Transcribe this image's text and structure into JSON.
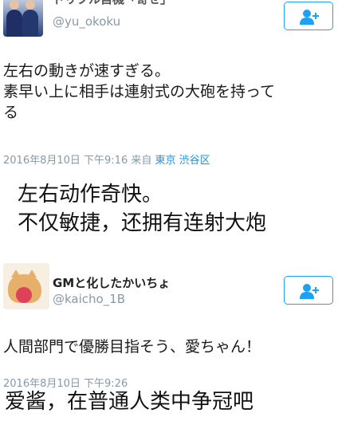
{
  "tweet1": {
    "author_name": "ドリブル自機「寄せ」",
    "handle": "@yu_okoku",
    "text": "左右の動きが速すぎる。\n素早い上に相手は連射式の大砲を持って\nる",
    "timestamp": "2016年8月10日 下午9:16",
    "source_prefix": "来自",
    "location": "東京 渋谷区",
    "follow_icon": "follow-user-icon"
  },
  "caption1": {
    "text": "左右动作奇快。\n不仅敏捷，还拥有连射大炮"
  },
  "tweet2": {
    "author_name": "GMと化したかいちょ",
    "handle": "@kaicho_1B",
    "text": "人間部門で優勝目指そう、愛ちゃん！",
    "timestamp": "2016年8月10日 下午9:26",
    "follow_icon": "follow-user-icon"
  },
  "caption2": {
    "text": "爱酱，在普通人类中争冠吧"
  },
  "colors": {
    "accent": "#1da1f2",
    "meta_gray": "#8899a6",
    "location_link": "#1b95e0"
  }
}
